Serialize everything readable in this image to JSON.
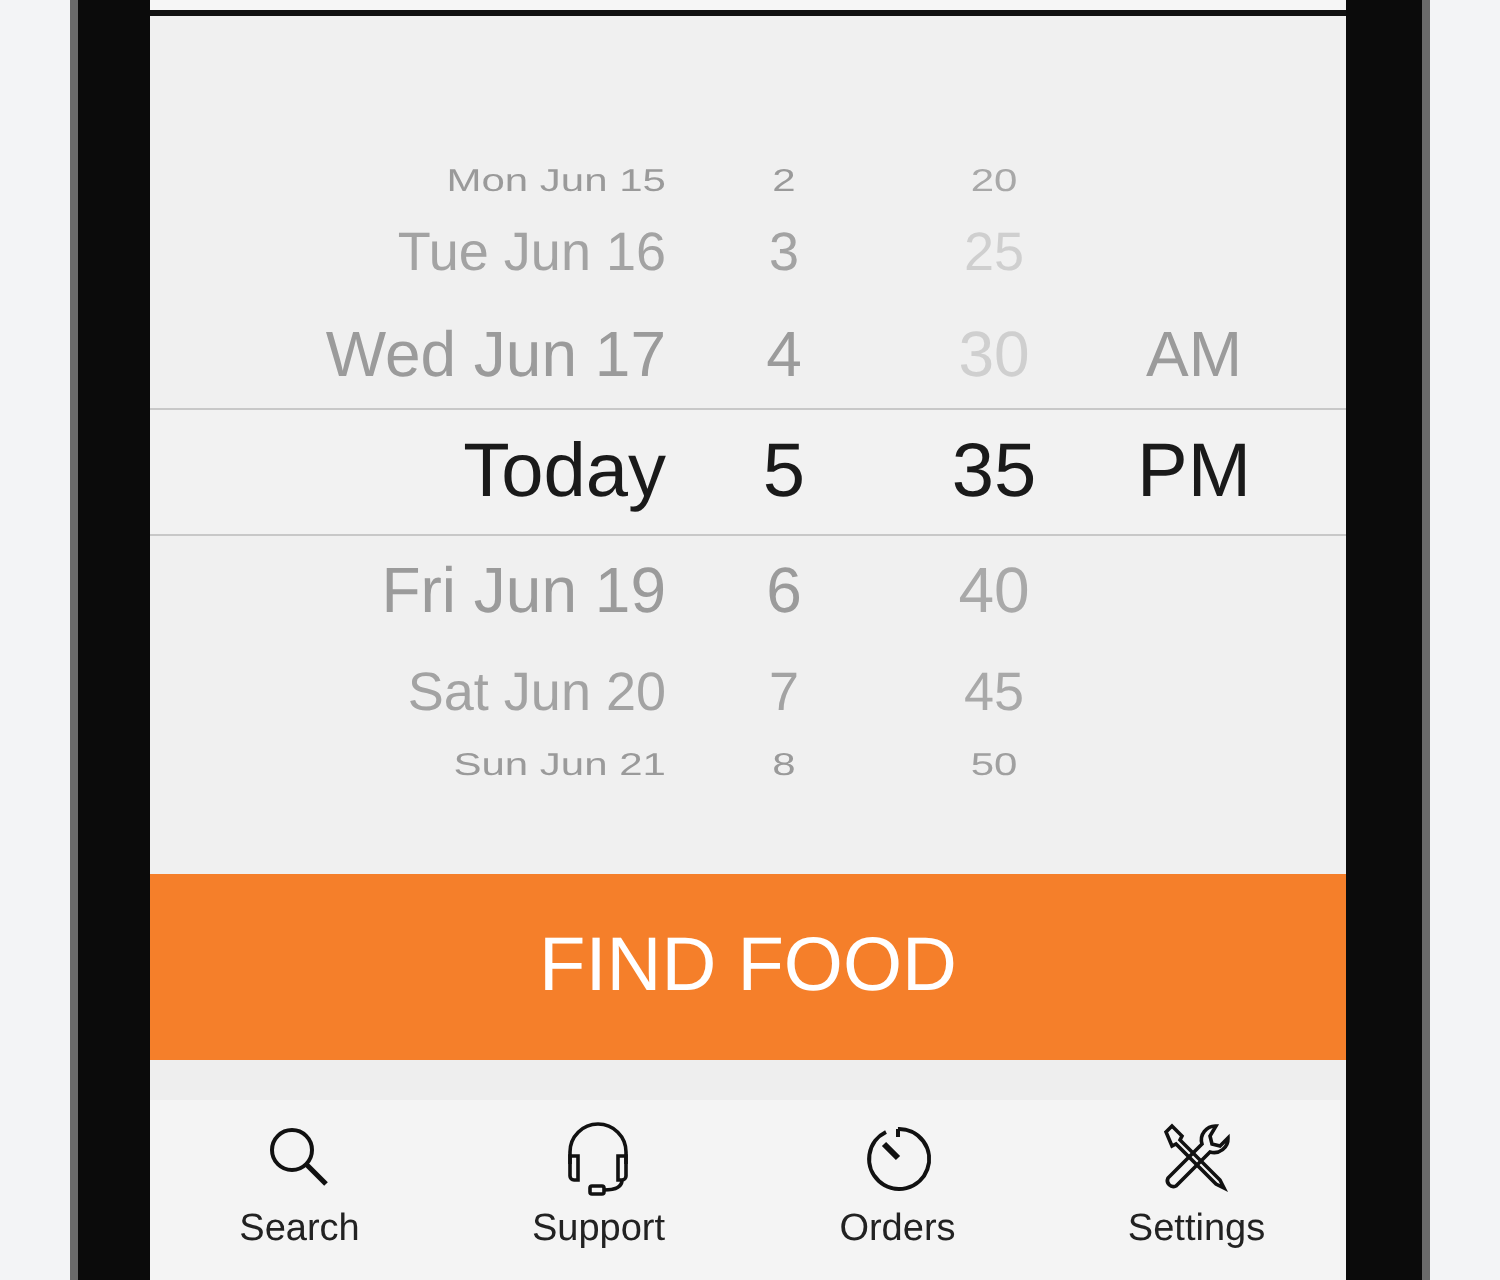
{
  "picker": {
    "rows": [
      {
        "date": "Mon Jun 15",
        "hour": "2",
        "minute": "20",
        "selected": false
      },
      {
        "date": "Tue Jun 16",
        "hour": "3",
        "minute": "25",
        "selected": false
      },
      {
        "date": "Wed Jun 17",
        "hour": "4",
        "minute": "30",
        "period": "AM",
        "selected": false
      },
      {
        "date": "Today",
        "hour": "5",
        "minute": "35",
        "period": "PM",
        "selected": true
      },
      {
        "date": "Fri Jun 19",
        "hour": "6",
        "minute": "40",
        "selected": false
      },
      {
        "date": "Sat Jun 20",
        "hour": "7",
        "minute": "45",
        "selected": false
      },
      {
        "date": "Sun Jun 21",
        "hour": "8",
        "minute": "50",
        "selected": false
      }
    ]
  },
  "button": {
    "label": "FIND FOOD"
  },
  "tab_bar": {
    "items": [
      {
        "label": "Search",
        "kind": "search"
      },
      {
        "label": "Support",
        "kind": "headset"
      },
      {
        "label": "Orders",
        "kind": "timer"
      },
      {
        "label": "Settings",
        "kind": "tools"
      }
    ]
  }
}
